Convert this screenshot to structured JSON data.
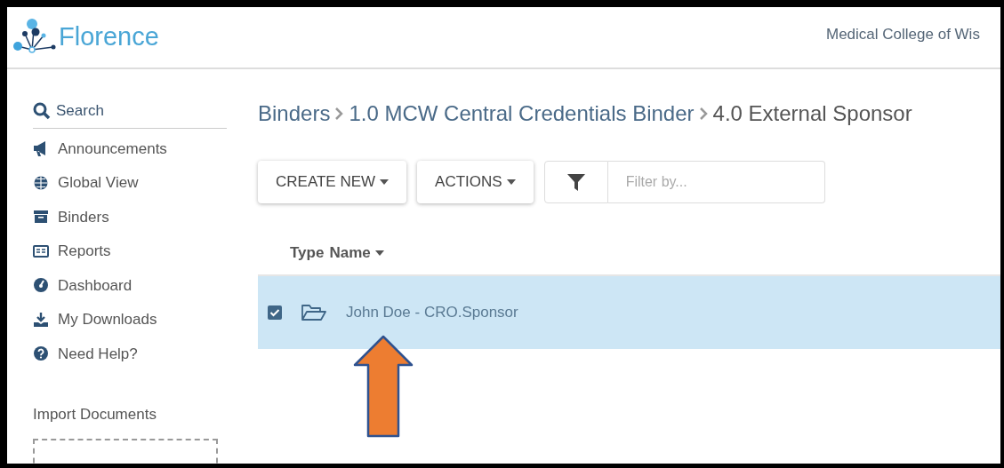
{
  "header": {
    "logo": "Florence",
    "organization": "Medical College of Wis"
  },
  "sidebar": {
    "search": "Search",
    "items": [
      {
        "label": "Announcements"
      },
      {
        "label": "Global View"
      },
      {
        "label": "Binders"
      },
      {
        "label": "Reports"
      },
      {
        "label": "Dashboard"
      },
      {
        "label": "My Downloads"
      },
      {
        "label": "Need Help?"
      }
    ],
    "import_label": "Import Documents"
  },
  "breadcrumb": [
    "Binders",
    "1.0 MCW Central Credentials Binder",
    "4.0 External Sponsor"
  ],
  "toolbar": {
    "buttons": [
      "CREATE NEW",
      "ACTIONS"
    ],
    "filter": {
      "placeholder": "Filter by..."
    }
  },
  "table": {
    "columns": [
      "Type",
      "Name"
    ],
    "rows": [
      {
        "name": "John Doe - CRO.Sponsor",
        "checked": true,
        "selected": true
      }
    ]
  }
}
